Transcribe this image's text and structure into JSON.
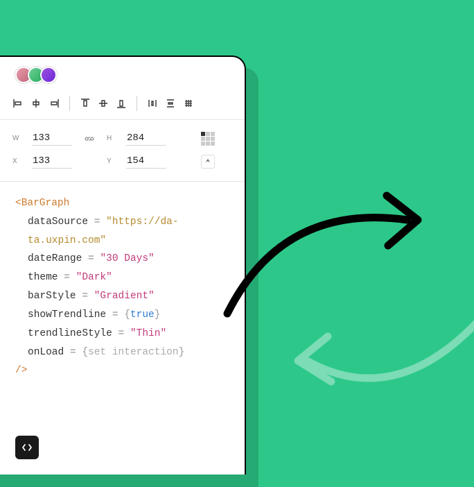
{
  "collaborators": [
    "user-1",
    "user-2",
    "user-3"
  ],
  "props": {
    "w_label": "W",
    "w_value": "133",
    "h_label": "H",
    "h_value": "284",
    "x_label": "X",
    "x_value": "133",
    "y_label": "Y",
    "y_value": "154"
  },
  "code": {
    "tag_open": "<BarGraph",
    "attrs": {
      "dataSource_name": "dataSource",
      "dataSource_value": "\"https://da-ta.uxpin.com\"",
      "dateRange_name": "dateRange",
      "dateRange_value": "\"30 Days\"",
      "theme_name": "theme",
      "theme_value": "\"Dark\"",
      "barStyle_name": "barStyle",
      "barStyle_value": "\"Gradient\"",
      "showTrendline_name": "showTrendline",
      "showTrendline_value": "true",
      "trendlineStyle_name": "trendlineStyle",
      "trendlineStyle_value": "\"Thin\"",
      "onLoad_name": "onLoad",
      "onLoad_value": "set interaction"
    },
    "eq": " = ",
    "brace_open": "{",
    "brace_close": "}",
    "tag_close": "/>"
  }
}
